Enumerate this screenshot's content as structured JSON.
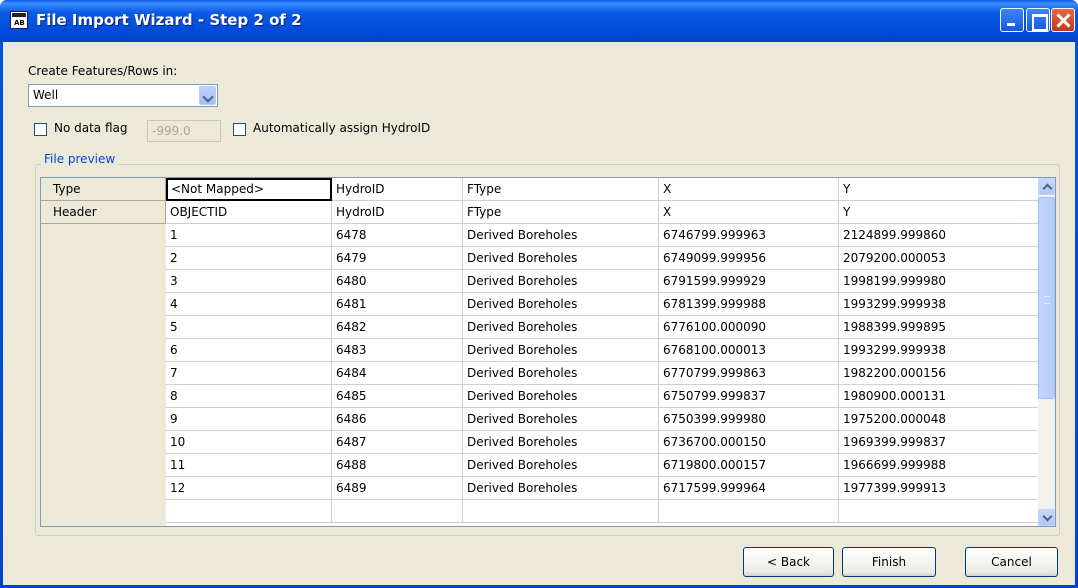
{
  "window": {
    "title": "File Import Wizard - Step 2 of 2"
  },
  "form": {
    "create_label": "Create Features/Rows in:",
    "create_value": "Well",
    "no_data_flag_label": "No data flag",
    "no_data_flag_checked": false,
    "no_data_value": "-999.0",
    "auto_hydroid_label": "Automatically assign HydroID",
    "auto_hydroid_checked": false
  },
  "preview": {
    "group_title": "File preview",
    "type_row": {
      "label": "Type",
      "cells": [
        "<Not Mapped>",
        "HydroID",
        "FType",
        "X",
        "Y"
      ]
    },
    "header_row": {
      "label": "Header",
      "cells": [
        "OBJECTID",
        "HydroID",
        "FType",
        "X",
        "Y"
      ]
    },
    "rows": [
      [
        "1",
        "6478",
        "Derived Boreholes",
        "6746799.999963",
        "2124899.999860"
      ],
      [
        "2",
        "6479",
        "Derived Boreholes",
        "6749099.999956",
        "2079200.000053"
      ],
      [
        "3",
        "6480",
        "Derived Boreholes",
        "6791599.999929",
        "1998199.999980"
      ],
      [
        "4",
        "6481",
        "Derived Boreholes",
        "6781399.999988",
        "1993299.999938"
      ],
      [
        "5",
        "6482",
        "Derived Boreholes",
        "6776100.000090",
        "1988399.999895"
      ],
      [
        "6",
        "6483",
        "Derived Boreholes",
        "6768100.000013",
        "1993299.999938"
      ],
      [
        "7",
        "6484",
        "Derived Boreholes",
        "6770799.999863",
        "1982200.000156"
      ],
      [
        "8",
        "6485",
        "Derived Boreholes",
        "6750799.999837",
        "1980900.000131"
      ],
      [
        "9",
        "6486",
        "Derived Boreholes",
        "6750399.999980",
        "1975200.000048"
      ],
      [
        "10",
        "6487",
        "Derived Boreholes",
        "6736700.000150",
        "1969399.999837"
      ],
      [
        "11",
        "6488",
        "Derived Boreholes",
        "6719800.000157",
        "1966699.999988"
      ],
      [
        "12",
        "6489",
        "Derived Boreholes",
        "6717599.999964",
        "1977399.999913"
      ]
    ]
  },
  "buttons": {
    "back": "< Back",
    "finish": "Finish",
    "cancel": "Cancel"
  },
  "icons": {
    "app": "wizard-app-icon",
    "minimize": "minimize-icon",
    "maximize": "maximize-icon",
    "close": "close-icon",
    "dropdown": "chevron-down-icon"
  },
  "colors": {
    "title_bar": "#0054e3",
    "dialog_bg": "#ece9d8",
    "group_title": "#0046d5"
  }
}
